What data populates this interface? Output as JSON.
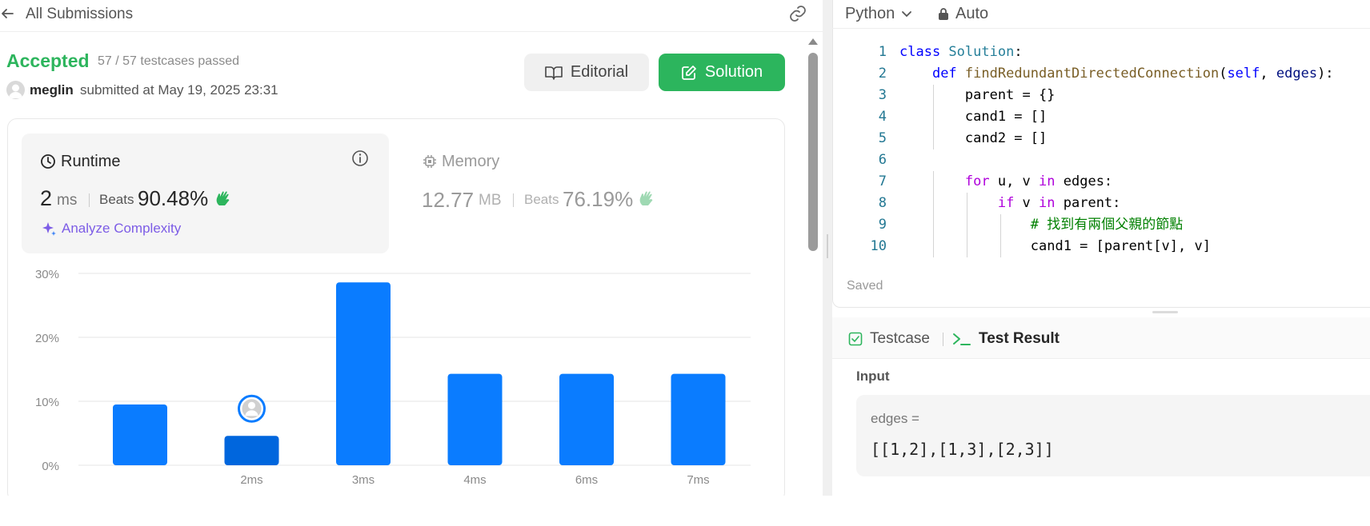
{
  "header": {
    "back_label": "All Submissions"
  },
  "submission": {
    "status": "Accepted",
    "testcases": "57 / 57 testcases passed",
    "username": "meglin",
    "submitted_at": "submitted at May 19, 2025 23:31"
  },
  "buttons": {
    "editorial": "Editorial",
    "solution": "Solution"
  },
  "runtime": {
    "label": "Runtime",
    "value": "2",
    "unit": "ms",
    "beats_label": "Beats",
    "beats_value": "90.48%",
    "analyze": "Analyze Complexity"
  },
  "memory": {
    "label": "Memory",
    "value": "12.77",
    "unit": "MB",
    "beats_label": "Beats",
    "beats_value": "76.19%"
  },
  "chart_data": {
    "type": "bar",
    "categories": [
      "",
      "2ms",
      "3ms",
      "4ms",
      "6ms",
      "7ms"
    ],
    "values": [
      9.5,
      4.6,
      28.6,
      14.3,
      14.3,
      14.3
    ],
    "highlight_index": 1,
    "y_ticks": [
      "0%",
      "10%",
      "20%",
      "30%"
    ],
    "ylim": [
      0,
      30
    ],
    "grid": true
  },
  "editor": {
    "language": "Python",
    "mode": "Auto",
    "saved": "Saved",
    "lines": [
      {
        "n": "1",
        "segments": [
          {
            "t": "class ",
            "c": "kw"
          },
          {
            "t": "Solution",
            "c": "cls"
          },
          {
            "t": ":",
            "c": ""
          }
        ]
      },
      {
        "n": "2",
        "segments": [
          {
            "t": "    ",
            "c": ""
          },
          {
            "t": "def ",
            "c": "kw"
          },
          {
            "t": "findRedundantDirectedConnection",
            "c": "fn"
          },
          {
            "t": "(",
            "c": ""
          },
          {
            "t": "self",
            "c": "kw"
          },
          {
            "t": ", ",
            "c": ""
          },
          {
            "t": "edges",
            "c": "prm"
          },
          {
            "t": "):",
            "c": ""
          }
        ]
      },
      {
        "n": "3",
        "segments": [
          {
            "t": "        parent = {}",
            "c": ""
          }
        ]
      },
      {
        "n": "4",
        "segments": [
          {
            "t": "        cand1 = []",
            "c": ""
          }
        ]
      },
      {
        "n": "5",
        "segments": [
          {
            "t": "        cand2 = []",
            "c": ""
          }
        ]
      },
      {
        "n": "6",
        "segments": [
          {
            "t": "",
            "c": ""
          }
        ]
      },
      {
        "n": "7",
        "segments": [
          {
            "t": "        ",
            "c": ""
          },
          {
            "t": "for",
            "c": "kw2"
          },
          {
            "t": " u, v ",
            "c": ""
          },
          {
            "t": "in",
            "c": "kw2"
          },
          {
            "t": " edges:",
            "c": ""
          }
        ]
      },
      {
        "n": "8",
        "segments": [
          {
            "t": "            ",
            "c": ""
          },
          {
            "t": "if",
            "c": "kw2"
          },
          {
            "t": " v ",
            "c": ""
          },
          {
            "t": "in",
            "c": "kw2"
          },
          {
            "t": " parent:",
            "c": ""
          }
        ]
      },
      {
        "n": "9",
        "segments": [
          {
            "t": "                ",
            "c": ""
          },
          {
            "t": "# 找到有兩個父親的節點",
            "c": "cm"
          }
        ]
      },
      {
        "n": "10",
        "segments": [
          {
            "t": "                cand1 = [parent[v], v]",
            "c": ""
          }
        ]
      }
    ]
  },
  "result": {
    "tab_testcase": "Testcase",
    "tab_result": "Test Result",
    "input_label": "Input",
    "input_name": "edges =",
    "input_value": "[[1,2],[1,3],[2,3]]"
  },
  "colors": {
    "accepted": "#2db55d",
    "bar": "#0a7cff",
    "bar_highlight": "#0066dd",
    "analyze": "#7c5ce6"
  },
  "icons": {
    "back": "arrow-left-icon",
    "link": "link-icon",
    "editorial": "book-icon",
    "solution": "edit-icon",
    "runtime": "clock-icon",
    "info": "info-icon",
    "memory": "chip-icon",
    "beats": "clap-icon",
    "analyze": "sparkle-icon",
    "lang": "chevron-down-icon",
    "mode": "lock-icon",
    "testcase": "checkbox-icon",
    "result": "terminal-icon"
  }
}
